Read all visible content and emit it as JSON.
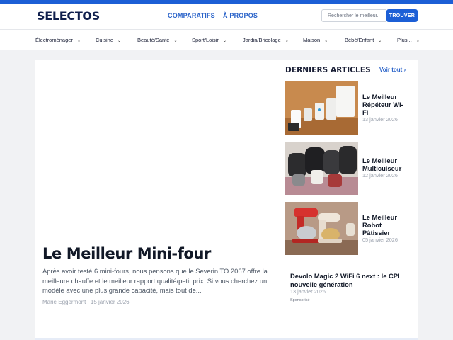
{
  "header": {
    "logo": "SELECTOS",
    "nav": [
      "COMPARATIFS",
      "À PROPOS"
    ],
    "search": {
      "placeholder": "Rechercher le meilleur.",
      "button": "TROUVER"
    }
  },
  "categories": [
    "Électroménager",
    "Cuisine",
    "Beauté/Santé",
    "Sport/Loisir",
    "Jardin/Bricolage",
    "Maison",
    "Bébé/Enfant",
    "Plus..."
  ],
  "featured": {
    "title": "Le Meilleur Mini-four",
    "excerpt": "Après avoir testé 6 mini-fours, nous pensons que le Severin TO 2067 offre la meilleure chauffe et le meilleur rapport qualité/petit prix. Si vous cherchez un modèle avec une plus grande capacité, mais tout de...",
    "meta": "Marie Eggermont | 15 janvier 2026"
  },
  "sidebar": {
    "title": "DERNIERS ARTICLES",
    "see_all": "Voir tout",
    "articles": [
      {
        "title": "Le Meilleur Répéteur Wi-Fi",
        "date": "13 janvier 2026"
      },
      {
        "title": "Le Meilleur Multicuiseur",
        "date": "12 janvier 2026"
      },
      {
        "title": "Le Meilleur Robot Pâtissier",
        "date": "05 janvier 2026"
      }
    ],
    "sponsored": {
      "title": "Devolo Magic 2 WiFi 6 next : le CPL nouvelle génération",
      "date": "13 janvier 2026",
      "tag": "Sponsorisé"
    }
  },
  "colors": {
    "accent": "#1c5fd6",
    "link": "#2a63c9",
    "navy": "#0f1f4d"
  },
  "icons": {
    "chevron": "chevron-down-icon",
    "arrow": "chevron-right-icon"
  }
}
